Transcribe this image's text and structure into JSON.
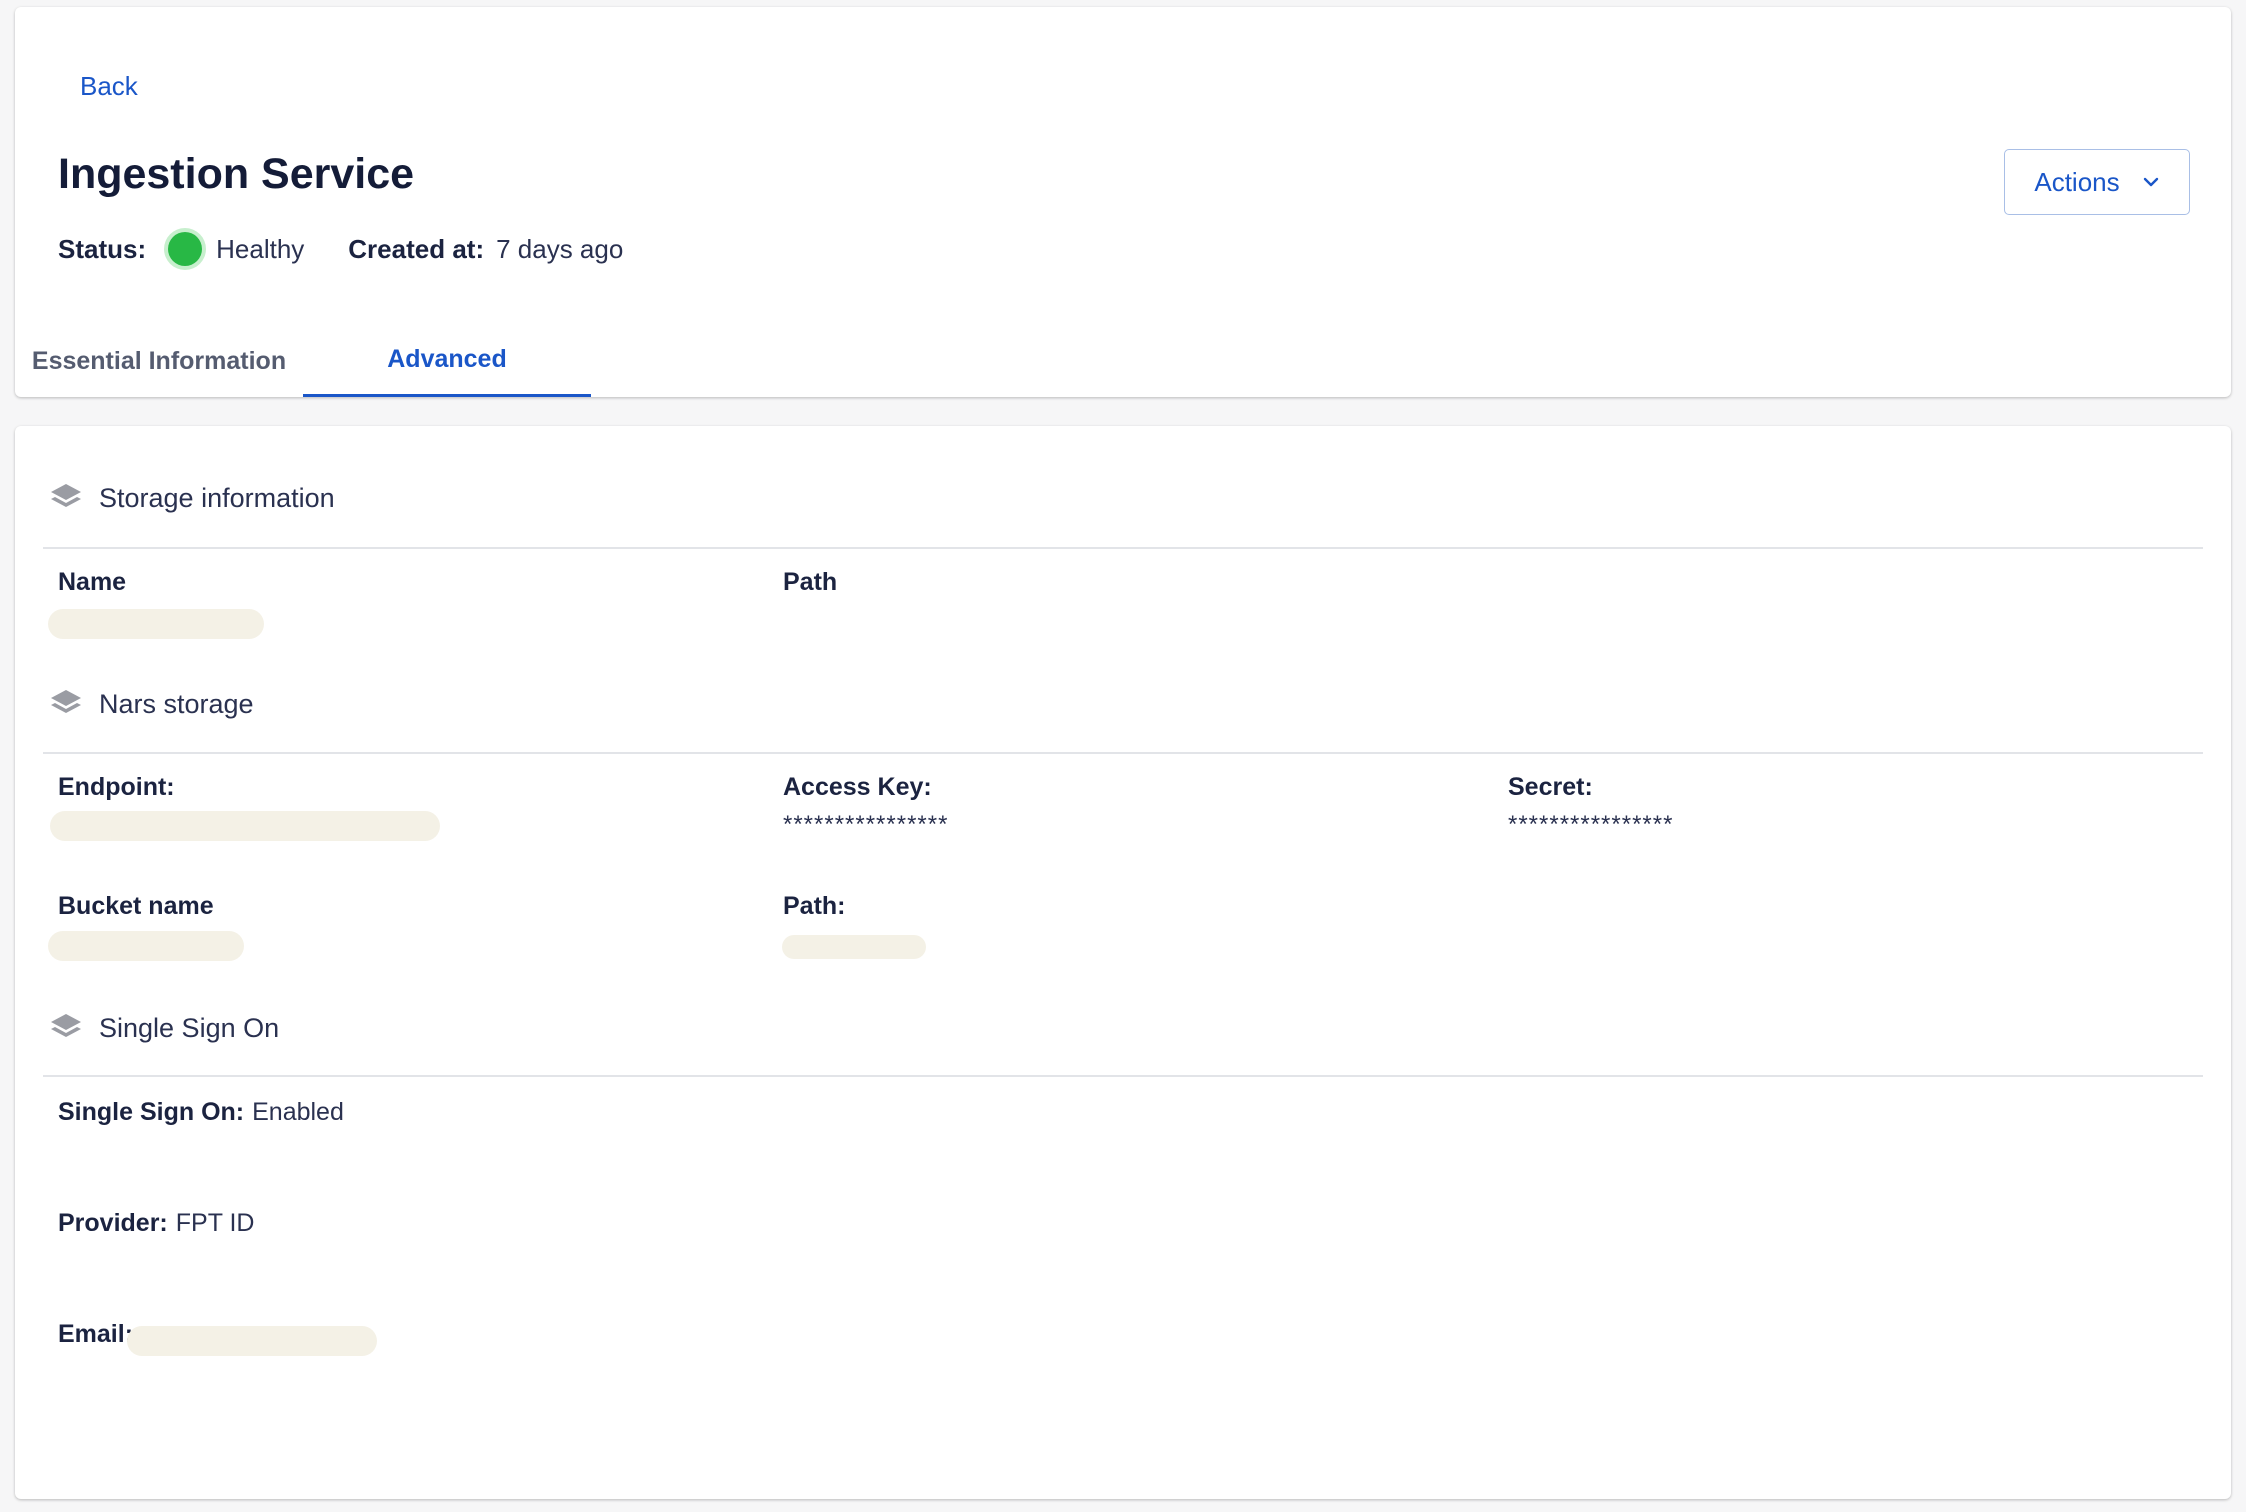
{
  "header": {
    "back_label": "Back",
    "title": "Ingestion Service",
    "status_label": "Status:",
    "status_value": "Healthy",
    "created_label": "Created at:",
    "created_value": "7 days ago",
    "actions_label": "Actions"
  },
  "tabs": [
    {
      "label": "Essential Information",
      "active": false
    },
    {
      "label": "Advanced",
      "active": true
    }
  ],
  "storage": {
    "title": "Storage information",
    "name_label": "Name",
    "path_label": "Path"
  },
  "nars": {
    "title": "Nars storage",
    "endpoint_label": "Endpoint:",
    "access_key_label": "Access Key:",
    "access_key_value": "****************",
    "secret_label": "Secret:",
    "secret_value": "****************",
    "bucket_label": "Bucket name",
    "path_label": "Path:"
  },
  "sso": {
    "title": "Single Sign On",
    "sso_label": "Single Sign On:",
    "sso_value": "Enabled",
    "provider_label": "Provider:",
    "provider_value": "FPT ID",
    "email_label": "Email:"
  },
  "colors": {
    "accent": "#1a56c8",
    "status_healthy": "#28b845",
    "redaction": "#f4f1e6"
  }
}
